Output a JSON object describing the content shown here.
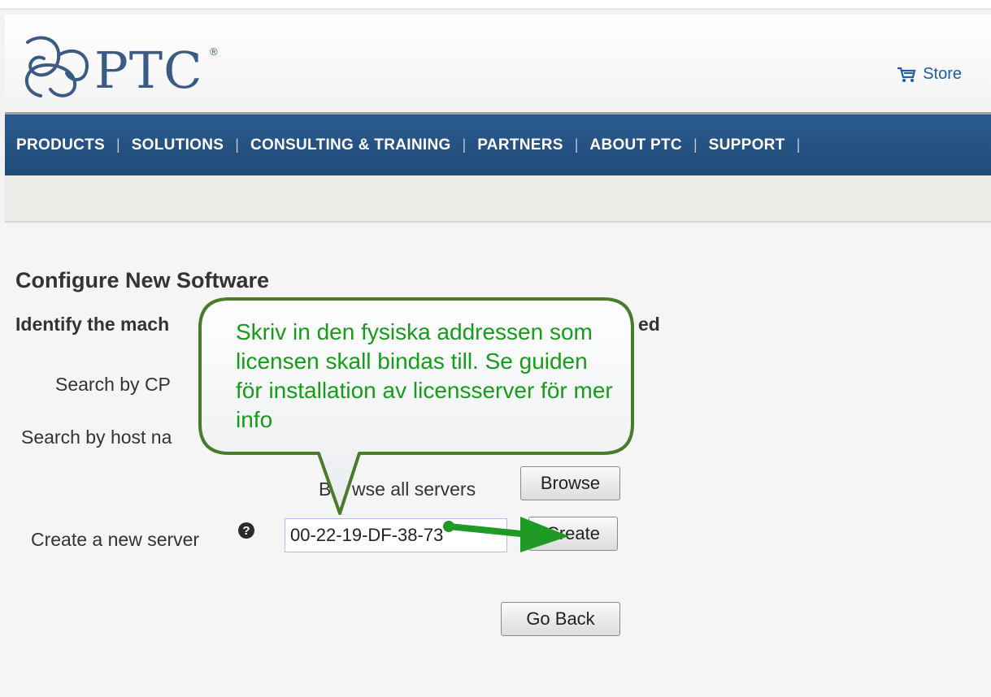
{
  "header": {
    "logo_text": "PTC",
    "logo_reg": "®",
    "store_label": "Store"
  },
  "nav": {
    "items": [
      {
        "label": "PRODUCTS"
      },
      {
        "label": "SOLUTIONS"
      },
      {
        "label": "CONSULTING & TRAINING"
      },
      {
        "label": "PARTNERS"
      },
      {
        "label": "ABOUT PTC"
      },
      {
        "label": "SUPPORT"
      }
    ],
    "separator": "|"
  },
  "main": {
    "title": "Configure New Software",
    "subtitle_left": "Identify the mach",
    "subtitle_right": "ed",
    "search_cpu_label": "Search by CP",
    "search_host_label": "Search by host na",
    "browse_prefix": "B",
    "browse_suffix": "wse all servers",
    "browse_button": "Browse",
    "create_label": "Create a new server",
    "create_input_value": "00-22-19-DF-38-73",
    "create_button": "Create",
    "go_back_button": "Go Back"
  },
  "callout": {
    "text": "Skriv in den fysiska addressen som licensen skall bindas till. Se guiden för installation av licensserver för mer info"
  },
  "colors": {
    "nav_bg": "#2b5b8e",
    "callout_border": "#4a7a2a",
    "callout_text": "#169b1a",
    "arrow": "#1f9a24",
    "link": "#1f5da5"
  }
}
